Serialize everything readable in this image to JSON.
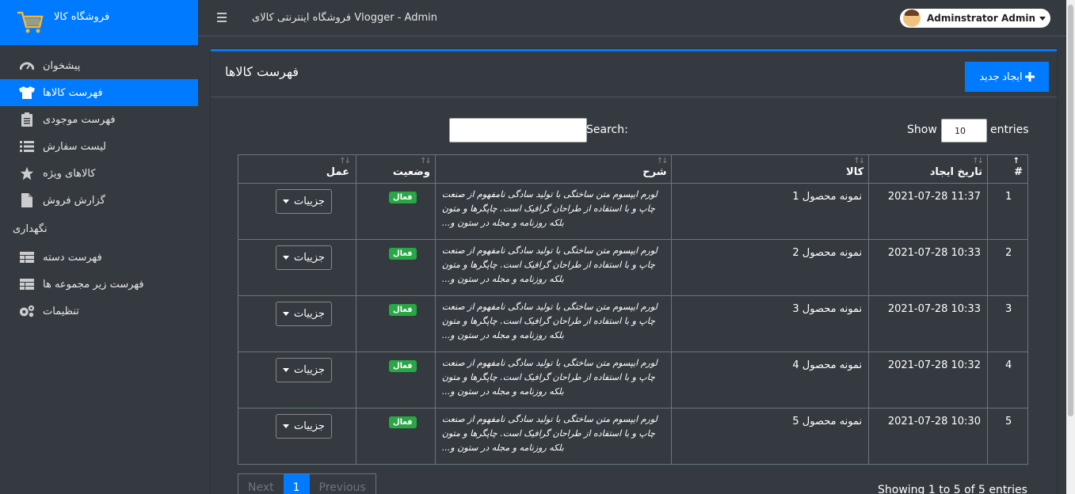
{
  "brand": {
    "name": "فروشگاه کالا"
  },
  "topbar": {
    "title": "فروشگاه اینترنتی کالای Vlogger - Admin",
    "user": "Adminstrator Admin"
  },
  "sidebar": {
    "items": [
      {
        "label": "پیشخوان",
        "icon": "dashboard-icon"
      },
      {
        "label": "فهرست کالاها",
        "icon": "tshirt-icon",
        "active": true
      },
      {
        "label": "فهرست موجودی",
        "icon": "clipboard-icon"
      },
      {
        "label": "لیست سفارش",
        "icon": "list-icon"
      },
      {
        "label": "کالاهای ویژه",
        "icon": "star-icon"
      },
      {
        "label": "گزارش فروش",
        "icon": "file-icon"
      }
    ],
    "section_header": "نگهداری",
    "maintenance_items": [
      {
        "label": "فهرست دسته",
        "icon": "table-icon"
      },
      {
        "label": "فهرست زیر مجموعه ها",
        "icon": "table-icon"
      },
      {
        "label": "تنظیمات",
        "icon": "cogs-icon"
      }
    ]
  },
  "card": {
    "title": "فهرست کالاها",
    "create_button": "ایجاد جدید"
  },
  "controls": {
    "show_label": "Show",
    "page_size": "10",
    "entries_label": "entries",
    "search_label": "Search:"
  },
  "table": {
    "headers": {
      "num": "#",
      "date": "تاریخ ایجاد",
      "product": "کالا",
      "desc": "شرح",
      "status": "وضعیت",
      "action": "عمل"
    },
    "rows": [
      {
        "num": "1",
        "date": "2021-07-28 11:37",
        "product": "نمونه محصول 1",
        "desc": "لورم ایپسوم متن ساختگی با تولید سادگی نامفهوم از صنعت چاپ و با استفاده از طراحان گرافیک است. چاپگرها و متون بلکه روزنامه و مجله در ستون و...",
        "status": "فعال",
        "action": "جزییات"
      },
      {
        "num": "2",
        "date": "2021-07-28 10:33",
        "product": "نمونه محصول 2",
        "desc": "لورم ایپسوم متن ساختگی با تولید سادگی نامفهوم از صنعت چاپ و با استفاده از طراحان گرافیک است. چاپگرها و متون بلکه روزنامه و مجله در ستون و...",
        "status": "فعال",
        "action": "جزییات"
      },
      {
        "num": "3",
        "date": "2021-07-28 10:33",
        "product": "نمونه محصول 3",
        "desc": "لورم ایپسوم متن ساختگی با تولید سادگی نامفهوم از صنعت چاپ و با استفاده از طراحان گرافیک است. چاپگرها و متون بلکه روزنامه و مجله در ستون و...",
        "status": "فعال",
        "action": "جزییات"
      },
      {
        "num": "4",
        "date": "2021-07-28 10:32",
        "product": "نمونه محصول 4",
        "desc": "لورم ایپسوم متن ساختگی با تولید سادگی نامفهوم از صنعت چاپ و با استفاده از طراحان گرافیک است. چاپگرها و متون بلکه روزنامه و مجله در ستون و...",
        "status": "فعال",
        "action": "جزییات"
      },
      {
        "num": "5",
        "date": "2021-07-28 10:30",
        "product": "نمونه محصول 5",
        "desc": "لورم ایپسوم متن ساختگی با تولید سادگی نامفهوم از صنعت چاپ و با استفاده از طراحان گرافیک است. چاپگرها و متون بلکه روزنامه و مجله در ستون و...",
        "status": "فعال",
        "action": "جزییات"
      }
    ]
  },
  "pagination": {
    "next": "Next",
    "current": "1",
    "previous": "Previous",
    "info": "Showing 1 to 5 of 5 entries"
  }
}
